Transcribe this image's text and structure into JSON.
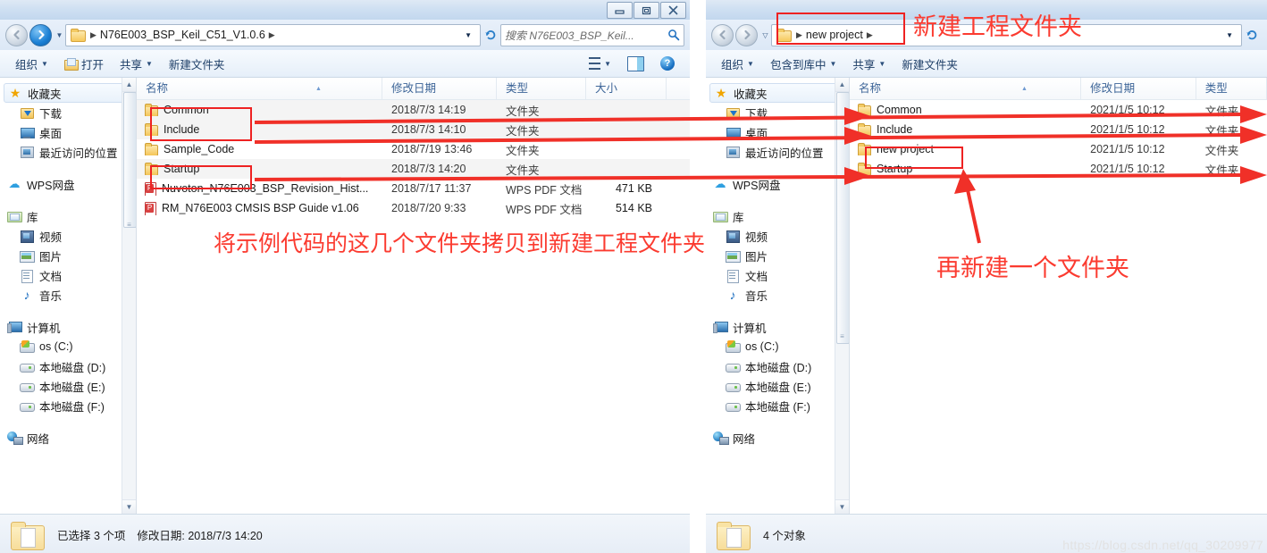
{
  "left_window": {
    "title_controls": [
      "minimize",
      "restore",
      "close"
    ],
    "address": {
      "folder_icon": "folder-icon",
      "crumbs": [
        "N76E003_BSP_Keil_C51_V1.0.6"
      ],
      "dropdown_caret": "▼",
      "refresh_icon": "refresh-icon"
    },
    "search": {
      "placeholder": "搜索 N76E003_BSP_Keil...",
      "icon": "search-icon"
    },
    "toolbar": {
      "organize": "组织",
      "open": "打开",
      "share": "共享",
      "new_folder": "新建文件夹",
      "view_icon": "view-list-icon",
      "preview_icon": "preview-pane-icon",
      "help_icon": "help-icon"
    },
    "nav": {
      "favorites": "收藏夹",
      "favorites_items": [
        {
          "label": "下载",
          "icon": "download-icon"
        },
        {
          "label": "桌面",
          "icon": "desktop-icon"
        },
        {
          "label": "最近访问的位置",
          "icon": "recent-places-icon"
        }
      ],
      "wps": {
        "label": "WPS网盘",
        "icon": "cloud-icon"
      },
      "library": "库",
      "library_items": [
        {
          "label": "视频",
          "icon": "video-icon"
        },
        {
          "label": "图片",
          "icon": "pictures-icon"
        },
        {
          "label": "文档",
          "icon": "documents-icon"
        },
        {
          "label": "音乐",
          "icon": "music-icon"
        }
      ],
      "computer": "计算机",
      "computer_items": [
        {
          "label": "os (C:)",
          "icon": "os-drive-icon"
        },
        {
          "label": "本地磁盘 (D:)",
          "icon": "drive-icon"
        },
        {
          "label": "本地磁盘 (E:)",
          "icon": "drive-icon"
        },
        {
          "label": "本地磁盘 (F:)",
          "icon": "drive-icon"
        }
      ],
      "network": {
        "label": "网络",
        "icon": "network-icon"
      }
    },
    "columns": [
      "名称",
      "修改日期",
      "类型",
      "大小"
    ],
    "rows": [
      {
        "name": "Common",
        "date": "2018/7/3 14:19",
        "type": "文件夹",
        "size": "",
        "icon": "folder-icon"
      },
      {
        "name": "Include",
        "date": "2018/7/3 14:10",
        "type": "文件夹",
        "size": "",
        "icon": "folder-icon"
      },
      {
        "name": "Sample_Code",
        "date": "2018/7/19 13:46",
        "type": "文件夹",
        "size": "",
        "icon": "folder-icon"
      },
      {
        "name": "Startup",
        "date": "2018/7/3 14:20",
        "type": "文件夹",
        "size": "",
        "icon": "folder-icon"
      },
      {
        "name": "Nuvoton_N76E003_BSP_Revision_Hist...",
        "date": "2018/7/17 11:37",
        "type": "WPS PDF 文档",
        "size": "471 KB",
        "icon": "pdf-icon"
      },
      {
        "name": "RM_N76E003 CMSIS BSP Guide v1.06",
        "date": "2018/7/20 9:33",
        "type": "WPS PDF 文档",
        "size": "514 KB",
        "icon": "pdf-icon"
      }
    ],
    "status": {
      "selected": "已选择 3 个项",
      "modified": "修改日期: 2018/7/3 14:20"
    }
  },
  "right_window": {
    "address": {
      "folder_icon": "folder-icon",
      "crumbs": [
        "new project"
      ],
      "dropdown_caret": "▼",
      "refresh_icon": "refresh-icon"
    },
    "toolbar": {
      "organize": "组织",
      "include_in_library": "包含到库中",
      "share": "共享",
      "new_folder": "新建文件夹"
    },
    "nav": {
      "favorites": "收藏夹",
      "favorites_items": [
        {
          "label": "下载",
          "icon": "download-icon"
        },
        {
          "label": "桌面",
          "icon": "desktop-icon"
        },
        {
          "label": "最近访问的位置",
          "icon": "recent-places-icon"
        }
      ],
      "wps": {
        "label": "WPS网盘",
        "icon": "cloud-icon"
      },
      "library": "库",
      "library_items": [
        {
          "label": "视频",
          "icon": "video-icon"
        },
        {
          "label": "图片",
          "icon": "pictures-icon"
        },
        {
          "label": "文档",
          "icon": "documents-icon"
        },
        {
          "label": "音乐",
          "icon": "music-icon"
        }
      ],
      "computer": "计算机",
      "computer_items": [
        {
          "label": "os (C:)",
          "icon": "os-drive-icon"
        },
        {
          "label": "本地磁盘 (D:)",
          "icon": "drive-icon"
        },
        {
          "label": "本地磁盘 (E:)",
          "icon": "drive-icon"
        },
        {
          "label": "本地磁盘 (F:)",
          "icon": "drive-icon"
        }
      ],
      "network": {
        "label": "网络",
        "icon": "network-icon"
      }
    },
    "columns": [
      "名称",
      "修改日期",
      "类型"
    ],
    "rows": [
      {
        "name": "Common",
        "date": "2021/1/5 10:12",
        "type": "文件夹",
        "icon": "folder-icon"
      },
      {
        "name": "Include",
        "date": "2021/1/5 10:12",
        "type": "文件夹",
        "icon": "folder-icon"
      },
      {
        "name": "new project",
        "date": "2021/1/5 10:12",
        "type": "文件夹",
        "icon": "folder-icon"
      },
      {
        "name": "Startup",
        "date": "2021/1/5 10:12",
        "type": "文件夹",
        "icon": "folder-icon"
      }
    ],
    "status": {
      "count": "4 个对象"
    }
  },
  "annotations": {
    "accent_color": "#fb3b30",
    "box_color": "#ee2222",
    "copy_note": "将示例代码的这几个文件夹拷贝到新建工程文件夹",
    "new_project_folder_note": "新建工程文件夹",
    "create_another_folder_note": "再新建一个文件夹"
  },
  "watermark": "https://blog.csdn.net/qq_30209977"
}
